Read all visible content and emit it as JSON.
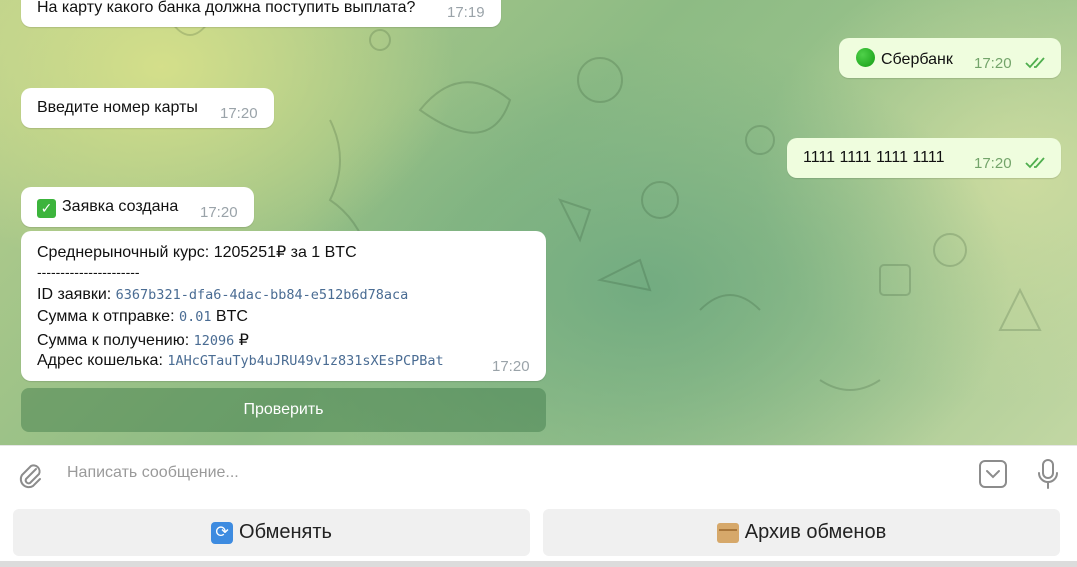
{
  "messages": {
    "m1": {
      "text": "На карту какого банка должна поступить выплата?",
      "time": "17:19"
    },
    "m2": {
      "text": "Сбербанк",
      "time": "17:20",
      "emoji": "green-circle-icon"
    },
    "m3": {
      "text": "Введите номер карты",
      "time": "17:20"
    },
    "m4": {
      "text": "1111 1111 1111 1111",
      "time": "17:20"
    },
    "m5": {
      "text": "Заявка создана",
      "time": "17:20",
      "emoji": "check-mark-icon"
    },
    "m6": {
      "rate": "Среднерыночный курс: 1205251₽ за 1 BTC",
      "separator": "----------------------",
      "id_label": "ID заявки: ",
      "id_value": "6367b321-dfa6-4dac-bb84-e512b6d78aca",
      "send_label": "Сумма к отправке: ",
      "send_value": "0.01",
      "send_unit": " BTC",
      "receive_label": "Сумма к получению: ",
      "receive_value": "12096",
      "receive_unit": " ₽",
      "wallet_label": "Адрес кошелька: ",
      "wallet_value": "1AHcGTauTyb4uJRU49v1z831sXEsPCPBat",
      "time": "17:20"
    }
  },
  "inline_button": {
    "label": "Проверить"
  },
  "composer": {
    "placeholder": "Написать сообщение..."
  },
  "keyboard": {
    "exchange_label": "Обменять",
    "archive_label": "Архив обменов"
  },
  "colors": {
    "outgoing_bubble": "#effdde",
    "incoming_bubble": "#ffffff",
    "read_ticks": "#4fae4e",
    "mono_text": "#4a6c93"
  }
}
